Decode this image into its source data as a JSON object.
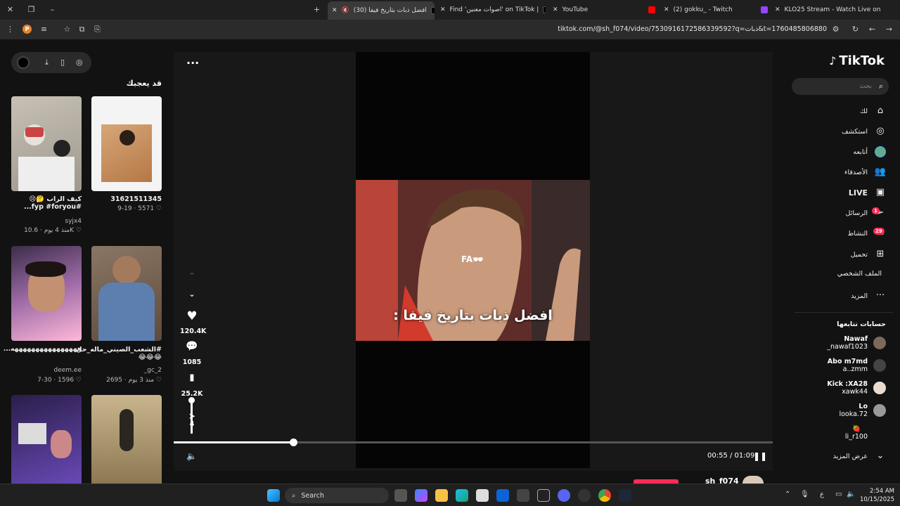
{
  "browser": {
    "tabs": [
      {
        "title": "افضل ذبات بتاريخ فيفا (30)",
        "active": true
      },
      {
        "title": "Find 'اصوات معنين' on TikTok |"
      },
      {
        "title": "YouTube"
      },
      {
        "title": "(2) gokku_ - Twitch"
      },
      {
        "title": "KLO25 Stream - Watch Live on"
      }
    ],
    "url": "tiktok.com/@sh_f074/video/7530916172586339592?q=ذبات&t=1760485806880",
    "profile_initial": "P"
  },
  "left_panel": {
    "heading": "قد يعجبك",
    "cards": [
      {
        "caption": "كيف الراب 🤔😢 #fyp #foryou...",
        "user": "syjx4",
        "likes": "10.6K",
        "date": "منذ 4 يوم"
      },
      {
        "caption": "31621511345",
        "user": "",
        "likes": "5571",
        "date": "9-19"
      },
      {
        "caption": "#الشعب_الصيني_ماله_حل 😂😂😂",
        "user": "_gc_2",
        "likes": "2695",
        "date": "منذ 3 يوم"
      },
      {
        "caption": "ههههههههههههههههه...",
        "user": "deem.ee",
        "likes": "1596",
        "date": "7-30"
      }
    ]
  },
  "player": {
    "subtitle": "افضل ذبات بتاريخ فيفا :",
    "overlay_text": "FA🕶",
    "likes": "120.4K",
    "comments": "1085",
    "saves": "25.2K",
    "shares": "4",
    "time": "00:55 / 01:09",
    "progress": 0.2
  },
  "sidebar": {
    "logo": "TikTok",
    "search_placeholder": "بحث",
    "nav": [
      {
        "label": "لك"
      },
      {
        "label": "استكشف"
      },
      {
        "label": "أتابعه"
      },
      {
        "label": "الأصدقاء"
      },
      {
        "label": "LIVE"
      },
      {
        "label": "الرسائل",
        "badge": "1"
      },
      {
        "label": "النشاط",
        "badge": "29"
      },
      {
        "label": "تحميل"
      },
      {
        "label": "الملف الشخصي"
      },
      {
        "label": "المزيد"
      }
    ],
    "following_heading": "حسابات تتابعها",
    "following": [
      {
        "display": "Nawaf",
        "handle": "_nawaf1023"
      },
      {
        "display": "Abo m7md",
        "handle": "a..zmm"
      },
      {
        "display": "Kick :XA28",
        "handle": "xawk44"
      },
      {
        "display": "Lo",
        "handle": "looka.72"
      },
      {
        "display": "🍓",
        "handle": "li_r100"
      }
    ],
    "see_more": "عرض المزيد"
  },
  "bottom_peek": {
    "username": "sh_f074"
  },
  "taskbar": {
    "search": "Search",
    "lang": "ع",
    "time": "2:54 AM",
    "date": "10/15/2025"
  }
}
